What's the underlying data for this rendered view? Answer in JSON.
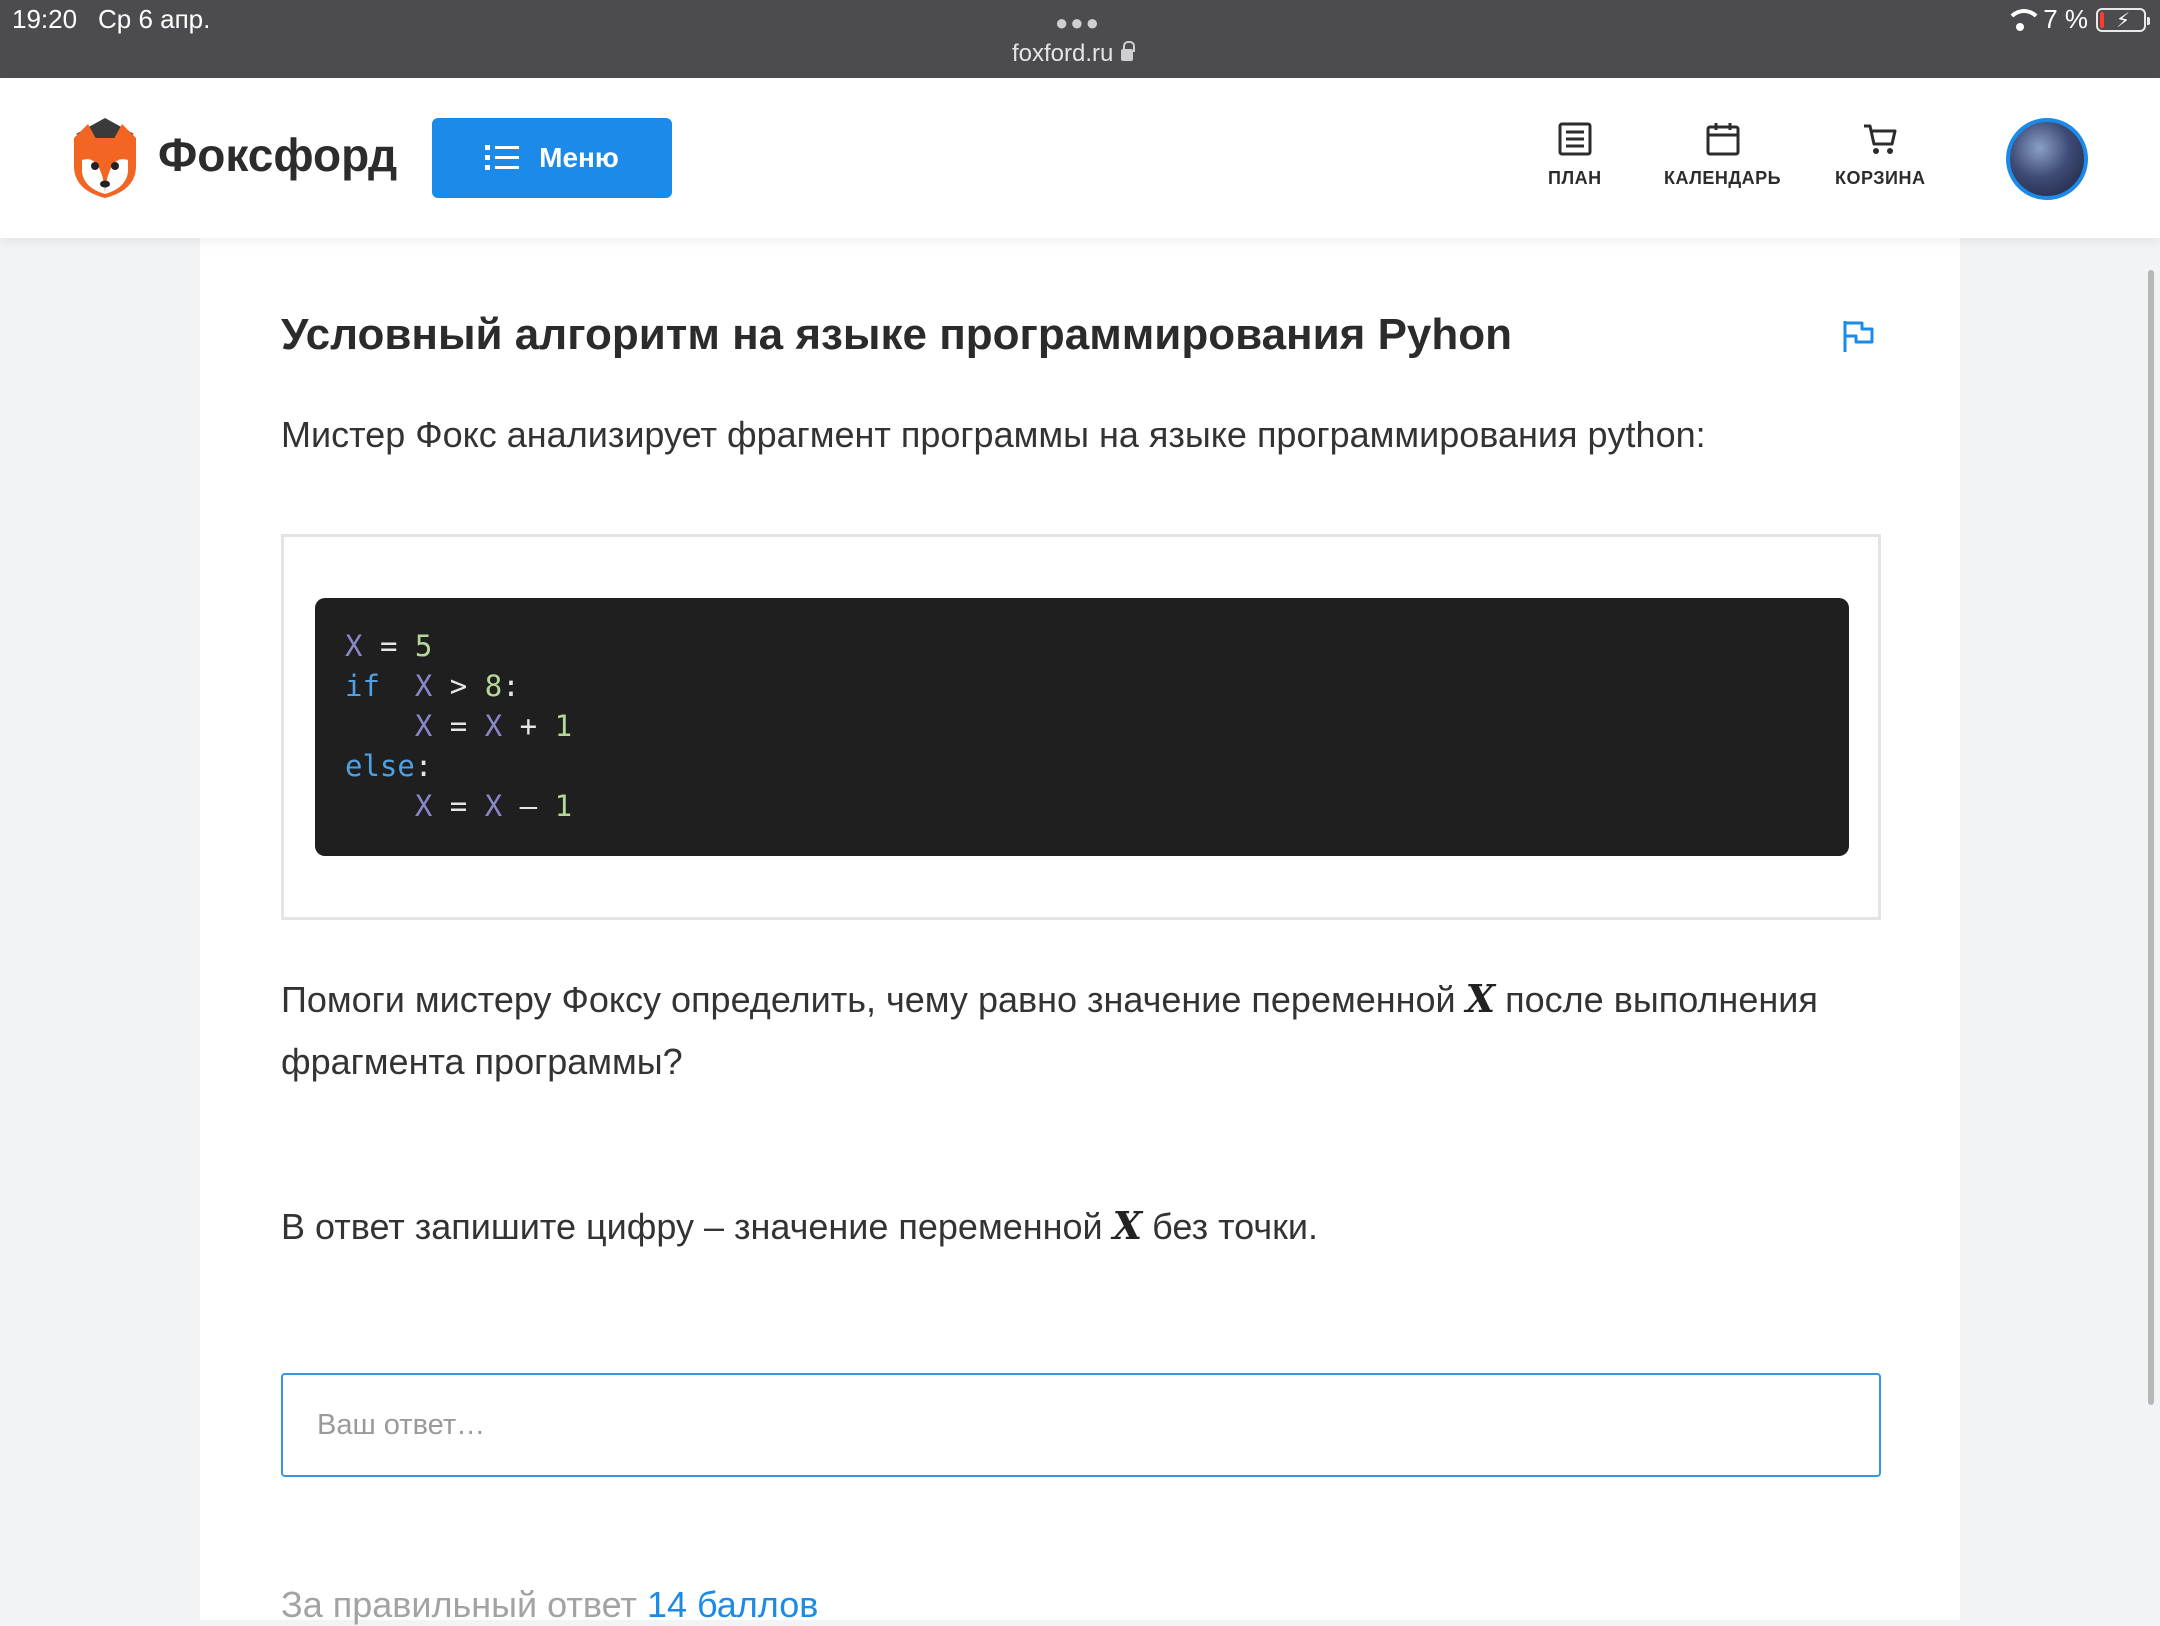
{
  "status_bar": {
    "time": "19:20",
    "date": "Ср 6 апр.",
    "url": "foxford.ru",
    "battery": "7 %"
  },
  "header": {
    "brand": "Фоксфорд",
    "menu_label": "Меню",
    "nav": [
      {
        "label": "ПЛАН",
        "icon": "list-icon"
      },
      {
        "label": "КАЛЕНДАРЬ",
        "icon": "calendar-icon"
      },
      {
        "label": "КОРЗИНА",
        "icon": "cart-icon"
      }
    ],
    "accent_color": "#1b8ae8"
  },
  "task": {
    "title": "Условный алгоритм на языке программирования Pyhon",
    "lead": "Мистер Фокс анализирует фрагмент программы на языке программирования python:",
    "code": {
      "line1": {
        "var": "X",
        "op": "=",
        "num": "5"
      },
      "line2": {
        "kw": "if",
        "var": "X",
        "op": ">",
        "num": "8",
        "colon": ":"
      },
      "line3": {
        "var1": "X",
        "op1": "=",
        "var2": "X",
        "op2": "+",
        "num": "1"
      },
      "line4": {
        "kw": "else",
        "colon": ":"
      },
      "line5": {
        "var1": "X",
        "op1": "=",
        "var2": "X",
        "op2": "–",
        "num": "1"
      }
    },
    "question_part1": "Помоги мистеру Фоксу определить, чему равно значение переменной",
    "question_var": "X",
    "question_part2": "после выполнения фрагмента программы?",
    "hint_part1": "В ответ запишите цифру – значение переменной",
    "hint_var": "X",
    "hint_part2": "без точки.",
    "answer_placeholder": "Ваш ответ…",
    "answer_value": "",
    "points_text": "За правильный ответ",
    "points_value": "14 баллов"
  }
}
